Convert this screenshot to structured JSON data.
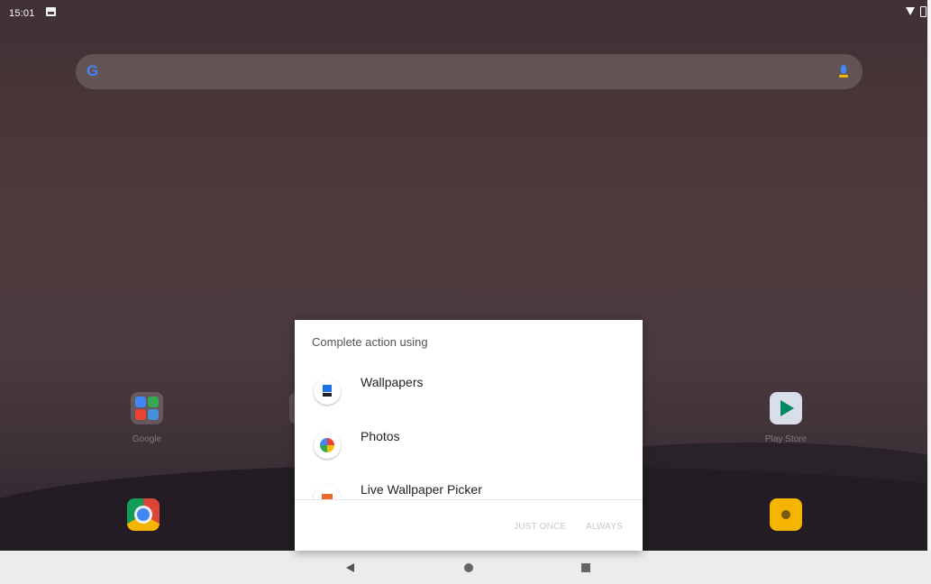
{
  "status_bar": {
    "time": "15:01",
    "notification_icon": "image-icon",
    "right_icons": [
      "wifi-icon",
      "battery-icon"
    ]
  },
  "search_bar": {
    "logo": "G",
    "mic_icon": "mic-icon"
  },
  "home_apps": [
    {
      "label": "Google",
      "icon": "folder-icon"
    },
    {
      "label": "Play Store",
      "icon": "play-store-icon"
    }
  ],
  "dock_apps": [
    {
      "icon": "chrome-icon"
    },
    {
      "icon": "files-icon"
    }
  ],
  "dialog": {
    "title": "Complete action using",
    "options": [
      {
        "label": "Wallpapers",
        "icon": "wallpapers-icon"
      },
      {
        "label": "Photos",
        "icon": "photos-icon"
      },
      {
        "label": "Live Wallpaper Picker",
        "icon": "live-wallpaper-icon"
      }
    ],
    "buttons": {
      "just_once": "JUST ONCE",
      "always": "ALWAYS"
    }
  },
  "nav_bar": {
    "buttons": [
      "back-icon",
      "home-icon",
      "recents-icon"
    ]
  }
}
